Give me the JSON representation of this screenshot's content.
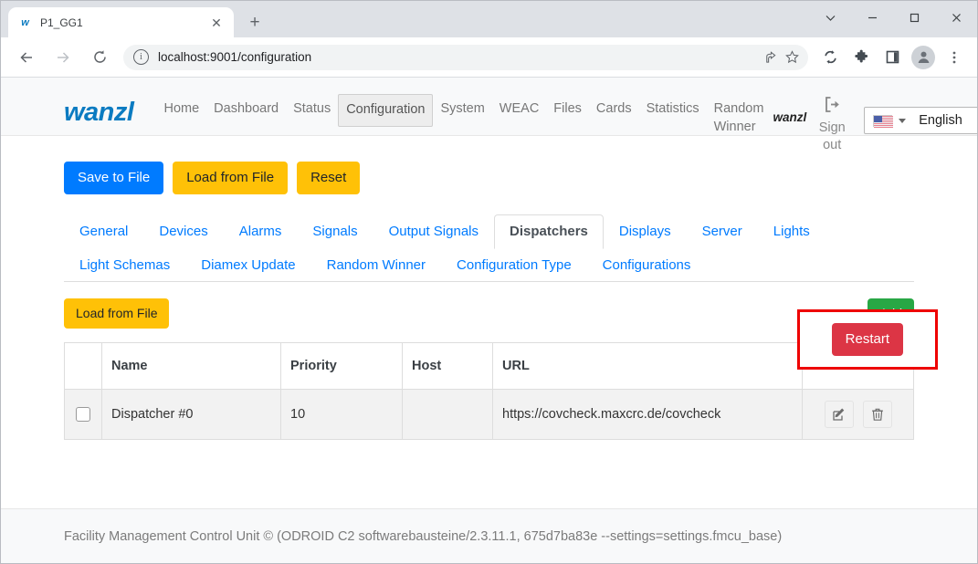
{
  "browser": {
    "tab": {
      "title": "P1_GG1",
      "favicon": "wanzl-w-icon",
      "close_label": "✕"
    },
    "newtab_label": "+",
    "window_controls": {
      "minimize": "–",
      "maximize": "□",
      "close": "✕",
      "more": "⌄"
    },
    "url": "localhost:9001/configuration",
    "toolbar_icons": [
      "back-arrow",
      "forward-arrow",
      "reload",
      "site-info",
      "share",
      "bookmark-star",
      "sync",
      "extensions-puzzle",
      "side-panel",
      "profile-avatar",
      "chrome-menu"
    ]
  },
  "navbar": {
    "brand": "wanzl",
    "links": [
      {
        "label": "Home",
        "active": false
      },
      {
        "label": "Dashboard",
        "active": false
      },
      {
        "label": "Status",
        "active": false
      },
      {
        "label": "Configuration",
        "active": true
      },
      {
        "label": "System",
        "active": false
      },
      {
        "label": "WEAC",
        "active": false
      },
      {
        "label": "Files",
        "active": false
      },
      {
        "label": "Cards",
        "active": false
      },
      {
        "label": "Statistics",
        "active": false
      },
      {
        "label": "Random Winner",
        "active": false
      }
    ],
    "user": "wanzl",
    "sign_out": "Sign out",
    "language": {
      "value": "English",
      "flag": "us-flag-icon"
    }
  },
  "toolbar": {
    "save_to_file": "Save to File",
    "load_from_file": "Load from File",
    "reset": "Reset",
    "restart": "Restart"
  },
  "config_tabs": [
    {
      "label": "General",
      "active": false
    },
    {
      "label": "Devices",
      "active": false
    },
    {
      "label": "Alarms",
      "active": false
    },
    {
      "label": "Signals",
      "active": false
    },
    {
      "label": "Output Signals",
      "active": false
    },
    {
      "label": "Dispatchers",
      "active": true
    },
    {
      "label": "Displays",
      "active": false
    },
    {
      "label": "Server",
      "active": false
    },
    {
      "label": "Lights",
      "active": false
    },
    {
      "label": "Light Schemas",
      "active": false
    },
    {
      "label": "Diamex Update",
      "active": false
    },
    {
      "label": "Random Winner",
      "active": false
    },
    {
      "label": "Configuration Type",
      "active": false
    },
    {
      "label": "Configurations",
      "active": false
    }
  ],
  "panel": {
    "load_from_file": "Load from File",
    "add": "Add"
  },
  "table": {
    "headers": [
      "",
      "Name",
      "Priority",
      "Host",
      "URL",
      ""
    ],
    "rows": [
      {
        "checked": false,
        "name": "Dispatcher #0",
        "priority": "10",
        "host": "",
        "url": "https://covcheck.maxcrc.de/covcheck",
        "actions": [
          "edit-icon",
          "delete-icon"
        ]
      }
    ]
  },
  "footer": {
    "text": "Facility Management Control Unit © (ODROID C2 softwarebausteine/2.3.11.1, 675d7ba83e --settings=settings.fmcu_base)"
  },
  "colors": {
    "primary": "#007bff",
    "warning": "#ffc107",
    "danger": "#dc3545",
    "success": "#28a745",
    "brand": "#0b7bc1",
    "annotation": "#ee0000"
  }
}
